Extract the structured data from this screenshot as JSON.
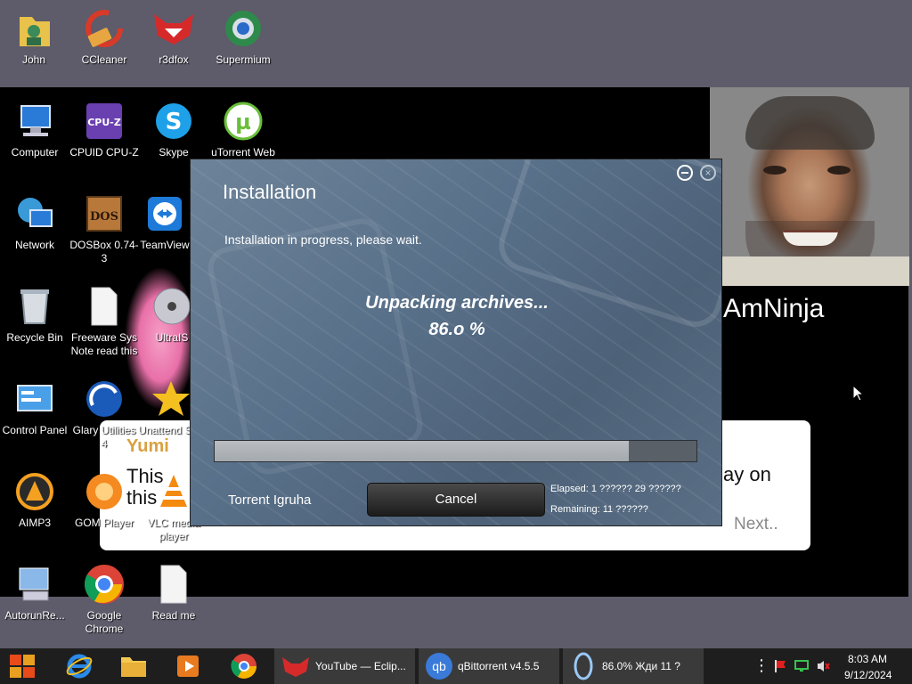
{
  "desktop": {
    "icons": [
      {
        "label": "John"
      },
      {
        "label": "CCleaner"
      },
      {
        "label": "r3dfox"
      },
      {
        "label": "Supermium"
      },
      {
        "label": "Computer"
      },
      {
        "label": "CPUID CPU-Z"
      },
      {
        "label": "Skype"
      },
      {
        "label": "uTorrent Web"
      },
      {
        "label": "Network"
      },
      {
        "label": "DOSBox 0.74-3"
      },
      {
        "label": "TeamView"
      },
      {
        "label": "Recycle Bin"
      },
      {
        "label": "Freeware Sys Note read this"
      },
      {
        "label": "UltraIS"
      },
      {
        "label": "Control Panel"
      },
      {
        "label": "Glary Utilities 4"
      },
      {
        "label": "Unattend Soft"
      },
      {
        "label": "AIMP3"
      },
      {
        "label": "GOM Player"
      },
      {
        "label": "VLC media player"
      },
      {
        "label": "AutorunRe..."
      },
      {
        "label": "Google Chrome"
      },
      {
        "label": "Read me"
      }
    ],
    "background_text": {
      "ninja": "AmNinja",
      "card_play": "ay on",
      "card_next": "Next..",
      "card_yumi": "Yumi",
      "card_this1": "This",
      "card_this2": "this"
    }
  },
  "installer": {
    "title": "Installation",
    "subtitle": "Installation in progress, please wait.",
    "status": "Unpacking archives...",
    "percent_text": "86.o %",
    "progress_fraction": 0.86,
    "brand": "Torrent Igruha",
    "cancel_label": "Cancel",
    "elapsed": "Elapsed:  1 ?????? 29 ??????",
    "remaining": "Remaining:  11 ??????",
    "close_glyph": "×"
  },
  "taskbar": {
    "pinned": [
      {
        "name": "start",
        "icon": "windows-logo-icon"
      },
      {
        "name": "internet-explorer",
        "icon": "ie-icon"
      },
      {
        "name": "file-explorer",
        "icon": "folder-icon"
      },
      {
        "name": "media-player",
        "icon": "media-icon"
      },
      {
        "name": "chrome",
        "icon": "chrome-icon"
      }
    ],
    "tasks": [
      {
        "label": "YouTube — Eclip..."
      },
      {
        "label": "qBittorrent v4.5.5"
      },
      {
        "label": "86.0%  Жди 11 ?"
      }
    ],
    "qb_glyph": "qb",
    "tray_more": "⋮",
    "clock_time": "8:03 AM",
    "clock_date": "9/12/2024"
  },
  "colors": {
    "taskbar_bg": "#1e1e1e",
    "dialog_bg": "#587089",
    "accent_red": "#e02020"
  }
}
